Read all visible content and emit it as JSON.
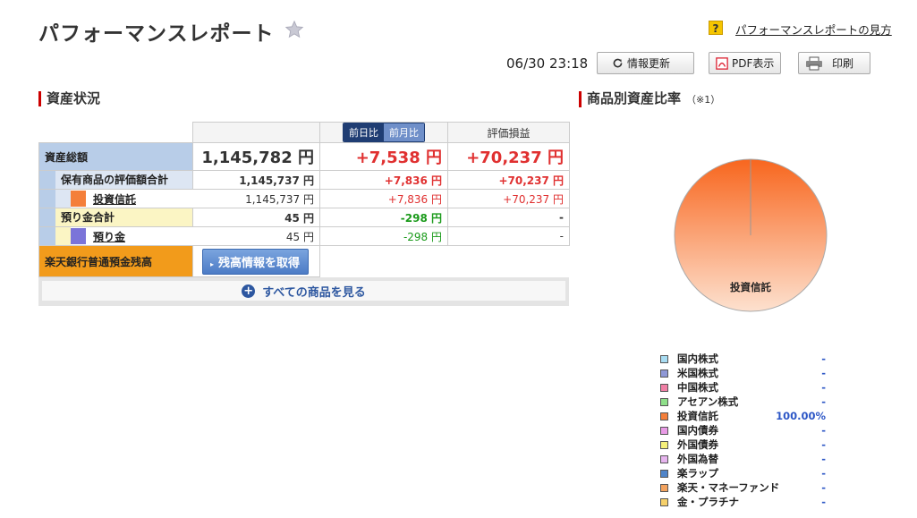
{
  "page": {
    "title": "パフォーマンスレポート",
    "help_link": "パフォーマンスレポートの見方",
    "help_icon_glyph": "?",
    "timestamp": "06/30 23:18",
    "buttons": {
      "refresh": "情報更新",
      "pdf": "PDF表示",
      "print": "印刷"
    }
  },
  "asset_status": {
    "heading": "資産状況",
    "toggle": {
      "day": "前日比",
      "month": "前月比",
      "selected": "前日比"
    },
    "col_unrealized": "評価損益",
    "total": {
      "label": "資産総額",
      "value": "1,145,782 円",
      "change": "+7,538 円",
      "pl": "+70,237 円"
    },
    "holdings": {
      "label": "保有商品の評価額合計",
      "value": "1,145,737 円",
      "change": "+7,836 円",
      "pl": "+70,237 円"
    },
    "fund": {
      "label": "投資信託",
      "value": "1,145,737 円",
      "change": "+7,836 円",
      "pl": "+70,237 円",
      "color": "#f47f3a"
    },
    "deposit_total": {
      "label": "預り金合計",
      "value": "45 円",
      "change": "-298 円",
      "pl": "-"
    },
    "deposit": {
      "label": "預り金",
      "value": "45 円",
      "change": "-298 円",
      "pl": "-",
      "color": "#7b74d9"
    },
    "bank": {
      "label": "楽天銀行普通預金残高",
      "button": "残高情報を取得"
    },
    "show_all": "すべての商品を見る"
  },
  "allocation": {
    "heading": "商品別資産比率",
    "note": "（※1）",
    "pie_label": "投資信託",
    "legend": [
      {
        "name": "国内株式",
        "value": "-",
        "color": "#a8dcf2"
      },
      {
        "name": "米国株式",
        "value": "-",
        "color": "#8f98d6"
      },
      {
        "name": "中国株式",
        "value": "-",
        "color": "#f07fa5"
      },
      {
        "name": "アセアン株式",
        "value": "-",
        "color": "#8fe08a"
      },
      {
        "name": "投資信託",
        "value": "100.00%",
        "color": "#f47f3a"
      },
      {
        "name": "国内債券",
        "value": "-",
        "color": "#e99be6"
      },
      {
        "name": "外国債券",
        "value": "-",
        "color": "#f6f07a"
      },
      {
        "name": "外国為替",
        "value": "-",
        "color": "#e6b4ee"
      },
      {
        "name": "楽ラップ",
        "value": "-",
        "color": "#4f84c8"
      },
      {
        "name": "楽天・マネーファンド",
        "value": "-",
        "color": "#f3a35f"
      },
      {
        "name": "金・プラチナ",
        "value": "-",
        "color": "#f6d06a"
      }
    ]
  },
  "chart_data": {
    "type": "pie",
    "categories": [
      "投資信託"
    ],
    "values": [
      100.0
    ]
  }
}
